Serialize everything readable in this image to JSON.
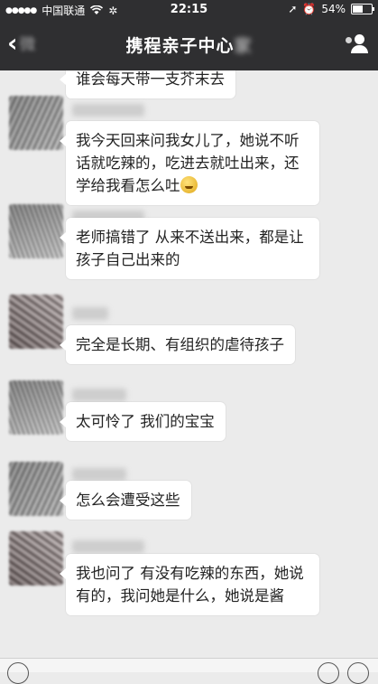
{
  "status_bar": {
    "carrier": "中国联通",
    "time": "22:15",
    "battery": "54%"
  },
  "nav": {
    "back_label": "微",
    "title": "携程亲子中心",
    "title_blurred": "家"
  },
  "messages": [
    {
      "text": "谁会每天带一支芥末去"
    },
    {
      "text": "我今天回来问我女儿了，她说不听话就吃辣的，吃进去就吐出来，还学给我看怎么吐"
    },
    {
      "text": "老师搞错了 从来不送出来，都是让孩子自己出来的"
    },
    {
      "text": "完全是长期、有组织的虐待孩子"
    },
    {
      "text": "太可怜了 我们的宝宝"
    },
    {
      "text": "怎么会遭受这些"
    },
    {
      "text": "我也问了 有没有吃辣的东西，她说有的，我问她是什么，她说是酱"
    }
  ]
}
